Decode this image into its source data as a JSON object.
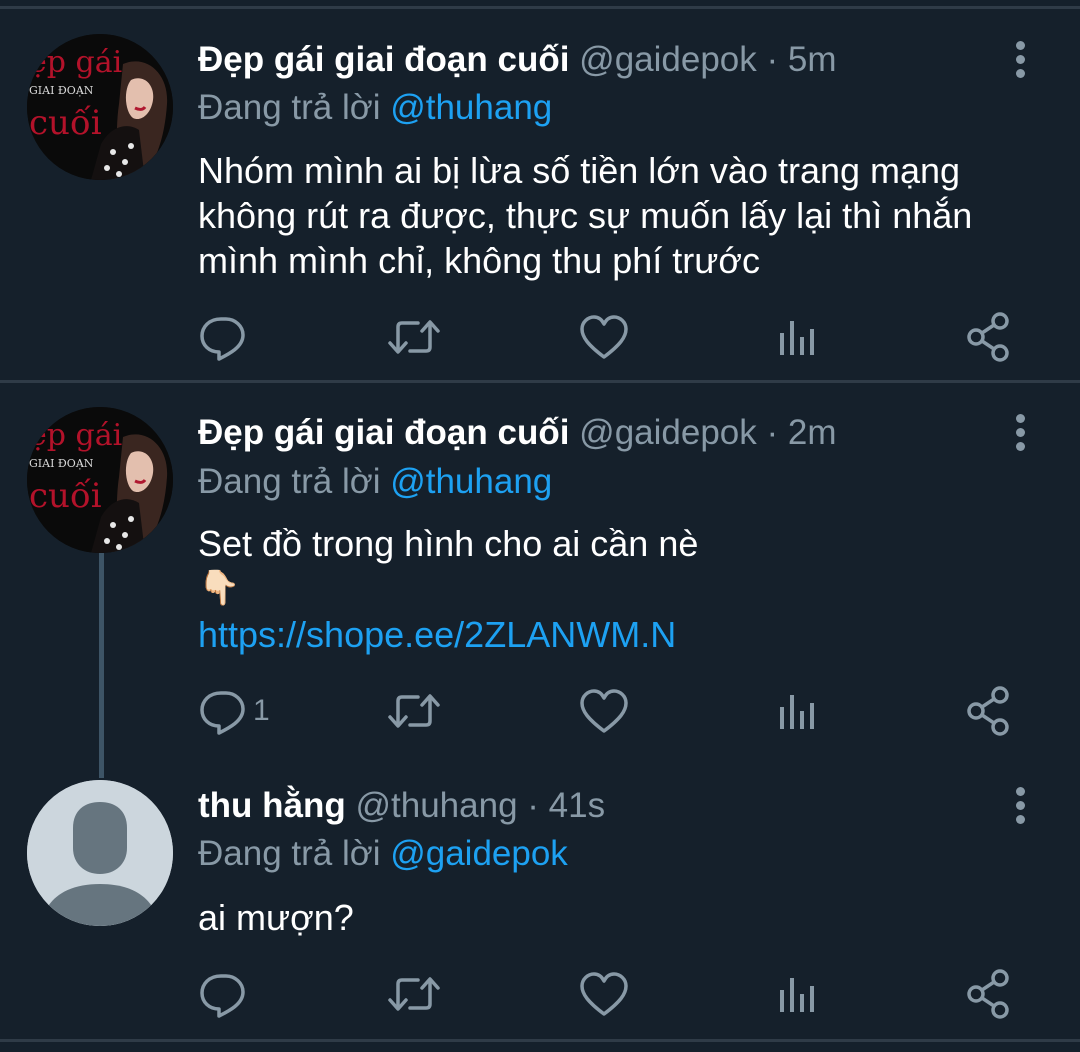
{
  "tweets": [
    {
      "author_name": "Đẹp gái giai đoạn cuối",
      "handle": "@gaidepok",
      "dot": "·",
      "time": "5m",
      "reply_prefix": "Đang trả lời ",
      "reply_to": "@thuhang",
      "text_lines": [
        "Nhóm mình ai bị lừa số tiền lớn vào trang mạng",
        "không rút ra được, thực sự muốn lấy lại thì nhắn",
        "mình mình chỉ, không thu phí trước"
      ],
      "avatar_text": [
        "ẹp gái",
        "GIAI ĐOẠN",
        "cuối"
      ],
      "reply_count": ""
    },
    {
      "author_name": "Đẹp gái giai đoạn cuối",
      "handle": "@gaidepok",
      "dot": "·",
      "time": "2m",
      "reply_prefix": "Đang trả lời ",
      "reply_to": "@thuhang",
      "text": "Set đồ trong hình cho ai cần nè",
      "emoji": "👇🏻",
      "link": "https://shope.ee/2ZLANWM.N",
      "avatar_text": [
        "ẹp gái",
        "GIAI ĐOẠN",
        "cuối"
      ],
      "reply_count": "1"
    },
    {
      "author_name": "thu hằng",
      "handle": "@thuhang",
      "dot": "·",
      "time": "41s",
      "reply_prefix": "Đang trả lời ",
      "reply_to": "@gaidepok",
      "text": "ai mượn?",
      "reply_count": ""
    }
  ],
  "icons": {
    "reply": "reply-icon",
    "retweet": "retweet-icon",
    "like": "heart-icon",
    "analytics": "analytics-icon",
    "share": "share-icon",
    "more": "more-vertical-icon"
  },
  "colors": {
    "background": "#15202b",
    "secondary_text": "#8899a6",
    "link": "#1da1f2",
    "divider": "#2f3b47"
  }
}
